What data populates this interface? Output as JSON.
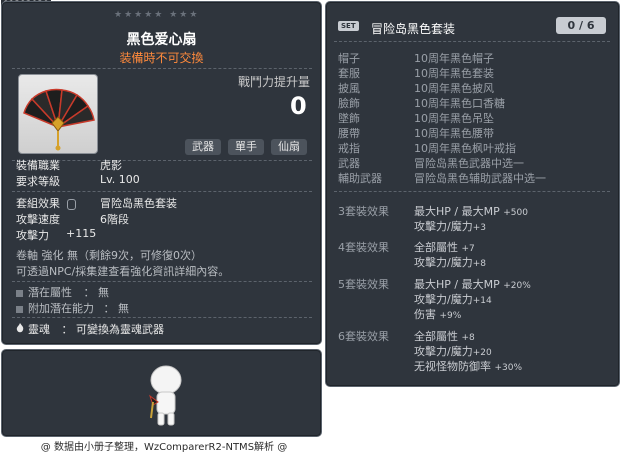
{
  "id_tag": "01292020",
  "item": {
    "stars": "★★★★★   ★★★",
    "name": "黑色爱心扇",
    "restriction": "装備時不可交換",
    "power_label": "戰鬥力提升量",
    "power_value": "0",
    "tags": [
      "武器",
      "單手",
      "仙扇"
    ],
    "stats": [
      {
        "label": "裝備職業",
        "value": "虎影"
      },
      {
        "label": "要求等級",
        "value": "Lv. 100"
      }
    ],
    "set_label": "套組效果",
    "set_value": "冒险岛黑色套装",
    "attack_speed_label": "攻擊速度",
    "attack_speed_value": "6階段",
    "attack_label": "攻擊力",
    "attack_value": "+115",
    "scroll_line": "卷軸 強化 無（剩餘9次，可修復0次）",
    "enhance_line": "可透過NPC/採集建查看強化資訊詳細內容。",
    "potential_label": "潛在屬性",
    "potential_value": "： 無",
    "additional_label": "附加潛在能力",
    "additional_value": "： 無",
    "soul_label": "靈魂",
    "soul_value": "： 可變換為靈魂武器"
  },
  "set": {
    "badge": "SET",
    "name": "冒险岛黑色套装",
    "count": "0 / 6",
    "pieces": [
      {
        "slot": "帽子",
        "item": "10周年黑色帽子"
      },
      {
        "slot": "套服",
        "item": "10周年黑色套装"
      },
      {
        "slot": "披風",
        "item": "10周年黑色披风"
      },
      {
        "slot": "臉飾",
        "item": "10周年黑色口香糖"
      },
      {
        "slot": "墜飾",
        "item": "10周年黑色吊坠"
      },
      {
        "slot": "腰帶",
        "item": "10周年黑色腰带"
      },
      {
        "slot": "戒指",
        "item": "10周年黑色枫叶戒指"
      },
      {
        "slot": "武器",
        "item": "冒险岛黑色武器中选一"
      },
      {
        "slot": "輔助武器",
        "item": "冒险岛黑色辅助武器中选一"
      }
    ],
    "bonuses": [
      {
        "head": "3套裝效果",
        "lines": [
          {
            "text": "最大HP / 最大MP",
            "val": "+500"
          },
          {
            "text": "攻擊力/魔力",
            "val": "+3"
          }
        ]
      },
      {
        "head": "4套裝效果",
        "lines": [
          {
            "text": "全部屬性",
            "val": "+7"
          },
          {
            "text": "攻擊力/魔力",
            "val": "+8"
          }
        ]
      },
      {
        "head": "5套裝效果",
        "lines": [
          {
            "text": "最大HP / 最大MP",
            "val": "+20%"
          },
          {
            "text": "攻擊力/魔力",
            "val": "+14"
          },
          {
            "text": "伤害",
            "val": "+9%"
          }
        ]
      },
      {
        "head": "6套裝效果",
        "lines": [
          {
            "text": "全部屬性",
            "val": "+8"
          },
          {
            "text": "攻擊力/魔力",
            "val": "+20"
          },
          {
            "text": "无视怪物防御率",
            "val": "+30%"
          }
        ]
      }
    ]
  },
  "footer": "@ 数据由小册子整理，WzComparerR2-NTMS解析 @"
}
